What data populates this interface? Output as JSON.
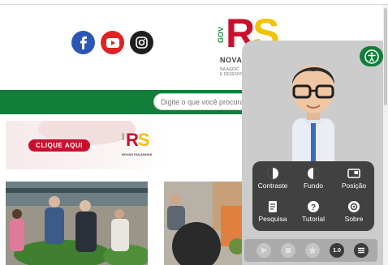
{
  "social": {
    "facebook_icon": "facebook-icon",
    "youtube_icon": "youtube-icon",
    "instagram_icon": "instagram-icon"
  },
  "logo": {
    "gov": "GOV",
    "rs_r": "R",
    "rs_s": "S",
    "name": "NOVAS",
    "sub_line1": "NA AGRIC",
    "sub_line2": "E DESENVO"
  },
  "search": {
    "placeholder": "Digite o que você procura"
  },
  "banner": {
    "cta_label": "CLIQUE AQUI",
    "mini_gov": "GOV",
    "mini_r": "R",
    "mini_s": "S",
    "mini_name": "NOVAS FAÇANHAS"
  },
  "accessibility_panel": {
    "toggle_icon": "accessibility-icon",
    "menu": [
      {
        "label": "Contraste",
        "icon": "contrast-icon"
      },
      {
        "label": "Fundo",
        "icon": "background-icon"
      },
      {
        "label": "Posição",
        "icon": "position-icon"
      },
      {
        "label": "Pesquisa",
        "icon": "search-doc-icon"
      },
      {
        "label": "Tutorial",
        "icon": "help-icon"
      },
      {
        "label": "Sobre",
        "icon": "about-icon"
      }
    ],
    "controls": {
      "play_icon": "play-icon",
      "stop_icon": "stop-icon",
      "favorite_icon": "star-icon",
      "speed_label": "1.0",
      "menu_icon": "menu-icon"
    }
  },
  "colors": {
    "brand_green": "#137d3a",
    "brand_red": "#c8102e",
    "brand_yellow": "#f3c300",
    "panel_gray": "#cccccc",
    "menu_dark": "#414141"
  }
}
